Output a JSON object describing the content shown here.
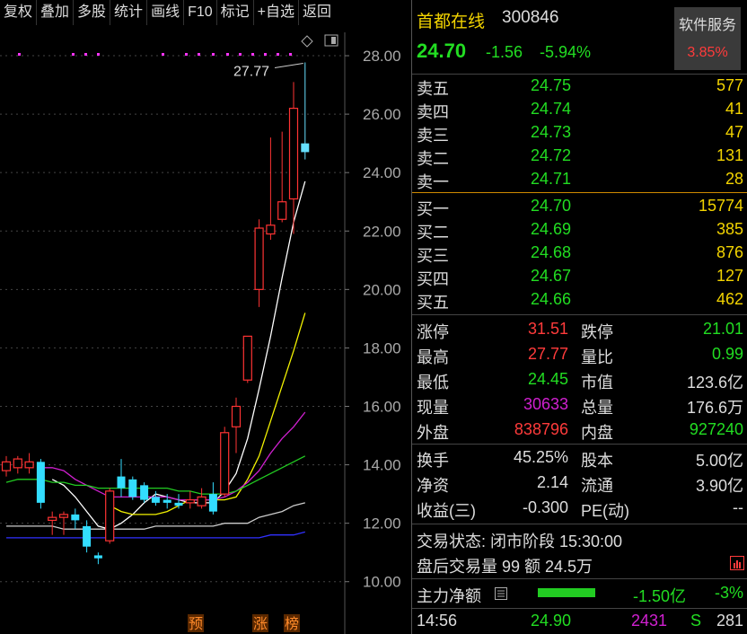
{
  "toolbar": [
    "复权",
    "叠加",
    "多股",
    "统计",
    "画线",
    "F10",
    "标记",
    "+自选",
    "返回"
  ],
  "stock": {
    "name": "首都在线",
    "code": "300846",
    "price": "24.70",
    "change": "-1.56",
    "change_pct": "-5.94%"
  },
  "service": {
    "label": "软件服务",
    "pct": "3.85%"
  },
  "chart_data": {
    "type": "candlestick",
    "ylim": [
      9.5,
      28.8
    ],
    "y_ticks": [
      "28.00",
      "26.00",
      "24.00",
      "22.00",
      "20.00",
      "18.00",
      "16.00",
      "14.00",
      "12.00",
      "10.00"
    ],
    "high_annotation": "27.77",
    "markers": [
      "预",
      "涨",
      "榜"
    ],
    "candles": [
      {
        "o": 13.8,
        "c": 14.1,
        "h": 14.3,
        "l": 13.6
      },
      {
        "o": 13.9,
        "c": 14.2,
        "h": 14.3,
        "l": 13.7
      },
      {
        "o": 13.9,
        "c": 14.1,
        "h": 14.4,
        "l": 13.7
      },
      {
        "o": 14.1,
        "c": 12.7,
        "h": 14.2,
        "l": 12.5
      },
      {
        "o": 12.1,
        "c": 12.2,
        "h": 12.4,
        "l": 11.6
      },
      {
        "o": 12.2,
        "c": 12.3,
        "h": 12.4,
        "l": 11.6
      },
      {
        "o": 12.3,
        "c": 12.1,
        "h": 12.5,
        "l": 11.8
      },
      {
        "o": 11.9,
        "c": 11.2,
        "h": 12.1,
        "l": 11.0
      },
      {
        "o": 10.9,
        "c": 10.8,
        "h": 11.0,
        "l": 10.6
      },
      {
        "o": 11.4,
        "c": 13.1,
        "h": 13.2,
        "l": 11.3
      },
      {
        "o": 13.6,
        "c": 13.2,
        "h": 14.2,
        "l": 12.9
      },
      {
        "o": 13.5,
        "c": 12.9,
        "h": 13.6,
        "l": 12.8
      },
      {
        "o": 13.3,
        "c": 12.8,
        "h": 13.4,
        "l": 12.7
      },
      {
        "o": 12.9,
        "c": 12.7,
        "h": 13.1,
        "l": 12.6
      },
      {
        "o": 12.8,
        "c": 12.7,
        "h": 13.0,
        "l": 12.5
      },
      {
        "o": 12.7,
        "c": 12.6,
        "h": 13.0,
        "l": 12.5
      },
      {
        "o": 12.7,
        "c": 12.8,
        "h": 13.1,
        "l": 12.5
      },
      {
        "o": 12.6,
        "c": 12.9,
        "h": 13.2,
        "l": 12.5
      },
      {
        "o": 13.0,
        "c": 12.4,
        "h": 13.4,
        "l": 12.3
      },
      {
        "o": 13.0,
        "c": 15.1,
        "h": 15.3,
        "l": 12.9
      },
      {
        "o": 15.3,
        "c": 16.0,
        "h": 16.3,
        "l": 14.4
      },
      {
        "o": 16.9,
        "c": 18.4,
        "h": 18.4,
        "l": 16.8
      },
      {
        "o": 20.0,
        "c": 22.1,
        "h": 22.4,
        "l": 19.4
      },
      {
        "o": 21.9,
        "c": 22.2,
        "h": 25.2,
        "l": 21.7
      },
      {
        "o": 22.4,
        "c": 23.0,
        "h": 25.4,
        "l": 22.3
      },
      {
        "o": 23.1,
        "c": 26.2,
        "h": 27.1,
        "l": 21.9
      },
      {
        "o": 25.0,
        "c": 24.7,
        "h": 27.77,
        "l": 24.45
      }
    ],
    "ma": [
      {
        "color": "#ffffff",
        "values": [
          null,
          null,
          null,
          null,
          13.5,
          13.3,
          12.9,
          12.4,
          11.9,
          11.8,
          12.0,
          12.3,
          12.7,
          13.0,
          12.9,
          12.8,
          12.7,
          12.7,
          12.7,
          13.1,
          13.7,
          14.9,
          16.6,
          18.4,
          20.4,
          22.3,
          23.7
        ]
      },
      {
        "color": "#f2f200",
        "values": [
          null,
          null,
          null,
          null,
          null,
          null,
          null,
          null,
          null,
          12.6,
          12.4,
          12.3,
          12.3,
          12.3,
          12.4,
          12.6,
          12.8,
          12.8,
          12.8,
          12.8,
          12.9,
          13.5,
          14.3,
          15.5,
          16.7,
          17.9,
          19.2
        ]
      },
      {
        "color": "#d020d0",
        "values": [
          null,
          null,
          null,
          13.9,
          13.9,
          13.8,
          13.5,
          13.3,
          13.1,
          12.9,
          12.9,
          12.9,
          12.9,
          12.9,
          12.9,
          12.8,
          12.8,
          12.8,
          12.8,
          12.9,
          13.1,
          13.4,
          13.8,
          14.4,
          14.9,
          15.3,
          15.8
        ]
      },
      {
        "color": "#22cc22",
        "values": [
          13.4,
          13.5,
          13.5,
          13.5,
          13.4,
          13.4,
          13.3,
          13.3,
          13.2,
          13.2,
          13.2,
          13.2,
          13.2,
          13.2,
          13.2,
          13.1,
          13.1,
          13.0,
          13.0,
          13.0,
          13.1,
          13.3,
          13.5,
          13.7,
          13.9,
          14.1,
          14.3
        ]
      },
      {
        "color": "#cccccc",
        "values": [
          11.9,
          11.9,
          11.9,
          11.9,
          11.9,
          11.8,
          11.8,
          11.8,
          11.8,
          11.8,
          11.8,
          11.8,
          11.8,
          11.9,
          11.9,
          11.9,
          11.9,
          11.9,
          11.9,
          12.0,
          12.0,
          12.0,
          12.2,
          12.3,
          12.4,
          12.6,
          12.7
        ]
      },
      {
        "color": "#3030ff",
        "values": [
          11.5,
          11.5,
          11.5,
          11.5,
          11.5,
          11.5,
          11.5,
          11.5,
          11.5,
          11.5,
          11.5,
          11.5,
          11.5,
          11.5,
          11.5,
          11.5,
          11.5,
          11.5,
          11.5,
          11.5,
          11.5,
          11.5,
          11.5,
          11.6,
          11.6,
          11.6,
          11.7
        ]
      }
    ]
  },
  "sell": [
    {
      "label": "卖五",
      "price": "24.75",
      "vol": "577"
    },
    {
      "label": "卖四",
      "price": "24.74",
      "vol": "41"
    },
    {
      "label": "卖三",
      "price": "24.73",
      "vol": "47"
    },
    {
      "label": "卖二",
      "price": "24.72",
      "vol": "131"
    },
    {
      "label": "卖一",
      "price": "24.71",
      "vol": "28"
    }
  ],
  "buy": [
    {
      "label": "买一",
      "price": "24.70",
      "vol": "15774"
    },
    {
      "label": "买二",
      "price": "24.69",
      "vol": "385"
    },
    {
      "label": "买三",
      "price": "24.68",
      "vol": "876"
    },
    {
      "label": "买四",
      "price": "24.67",
      "vol": "127"
    },
    {
      "label": "买五",
      "price": "24.66",
      "vol": "462"
    }
  ],
  "stats": {
    "zt_l": "涨停",
    "zt_v": "31.51",
    "dt_l": "跌停",
    "dt_v": "21.01",
    "zg_l": "最高",
    "zg_v": "27.77",
    "lb_l": "量比",
    "lb_v": "0.99",
    "zd_l": "最低",
    "zd_v": "24.45",
    "sz_l": "市值",
    "sz_v": "123.6亿",
    "xl_l": "现量",
    "xl_v": "30633",
    "zl_l": "总量",
    "zl_v": "176.6万",
    "wp_l": "外盘",
    "wp_v": "838796",
    "np_l": "内盘",
    "np_v": "927240",
    "hs_l": "换手",
    "hs_v": "45.25%",
    "gb_l": "股本",
    "gb_v": "5.00亿",
    "jz_l": "净资",
    "jz_v": "2.14",
    "lt_l": "流通",
    "lt_v": "3.90亿",
    "sy_l": "收益(三)",
    "sy_v": "-0.300",
    "pe_l": "PE(动)",
    "pe_v": "--"
  },
  "trade": {
    "status": "交易状态: 闭市阶段 15:30:00",
    "after": "盘后交易量 99 额 24.5万"
  },
  "main_flow": {
    "label": "主力净额",
    "value": "-1.50亿",
    "pct": "-3%"
  },
  "tick": {
    "time": "14:56",
    "price": "24.90",
    "vol": "2431",
    "side": "S",
    "count": "281"
  }
}
